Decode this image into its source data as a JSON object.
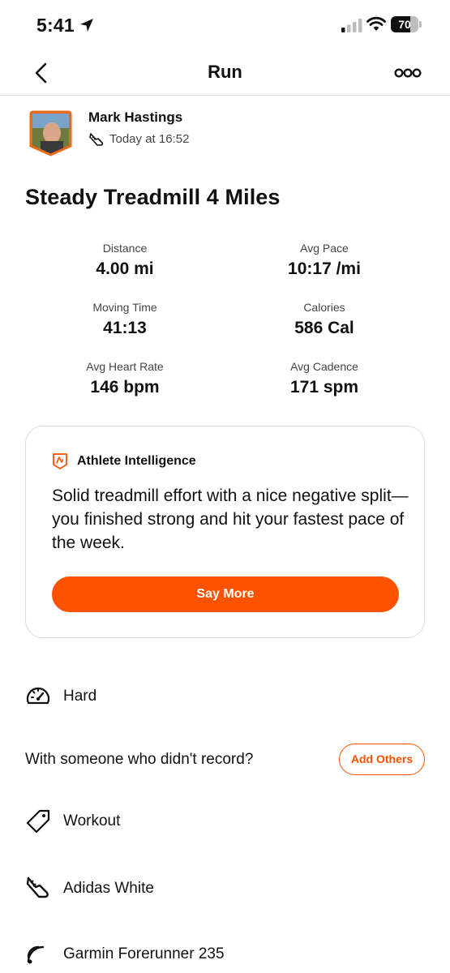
{
  "status_bar": {
    "time": "5:41",
    "battery_percent": "70",
    "battery_level": 0.7
  },
  "nav": {
    "title": "Run"
  },
  "athlete": {
    "name": "Mark Hastings",
    "timestamp": "Today at 16:52"
  },
  "activity": {
    "title": "Steady Treadmill 4 Miles",
    "stats": [
      {
        "label": "Distance",
        "value": "4.00 mi"
      },
      {
        "label": "Avg Pace",
        "value": "10:17 /mi"
      },
      {
        "label": "Moving Time",
        "value": "41:13"
      },
      {
        "label": "Calories",
        "value": "586 Cal"
      },
      {
        "label": "Avg Heart Rate",
        "value": "146 bpm"
      },
      {
        "label": "Avg Cadence",
        "value": "171 spm"
      }
    ]
  },
  "ai_card": {
    "title": "Athlete Intelligence",
    "text": "Solid treadmill effort with a nice negative split—you finished strong and hit your fastest pace of the week.",
    "button_label": "Say More"
  },
  "details": {
    "effort": "Hard",
    "with_others_prompt": "With someone who didn't record?",
    "add_others_label": "Add Others",
    "workout_type": "Workout",
    "shoes": "Adidas White",
    "device": "Garmin Forerunner 235"
  },
  "colors": {
    "accent": "#fc5200",
    "text": "#111111",
    "muted": "#444444",
    "border": "#dcdcdc"
  }
}
